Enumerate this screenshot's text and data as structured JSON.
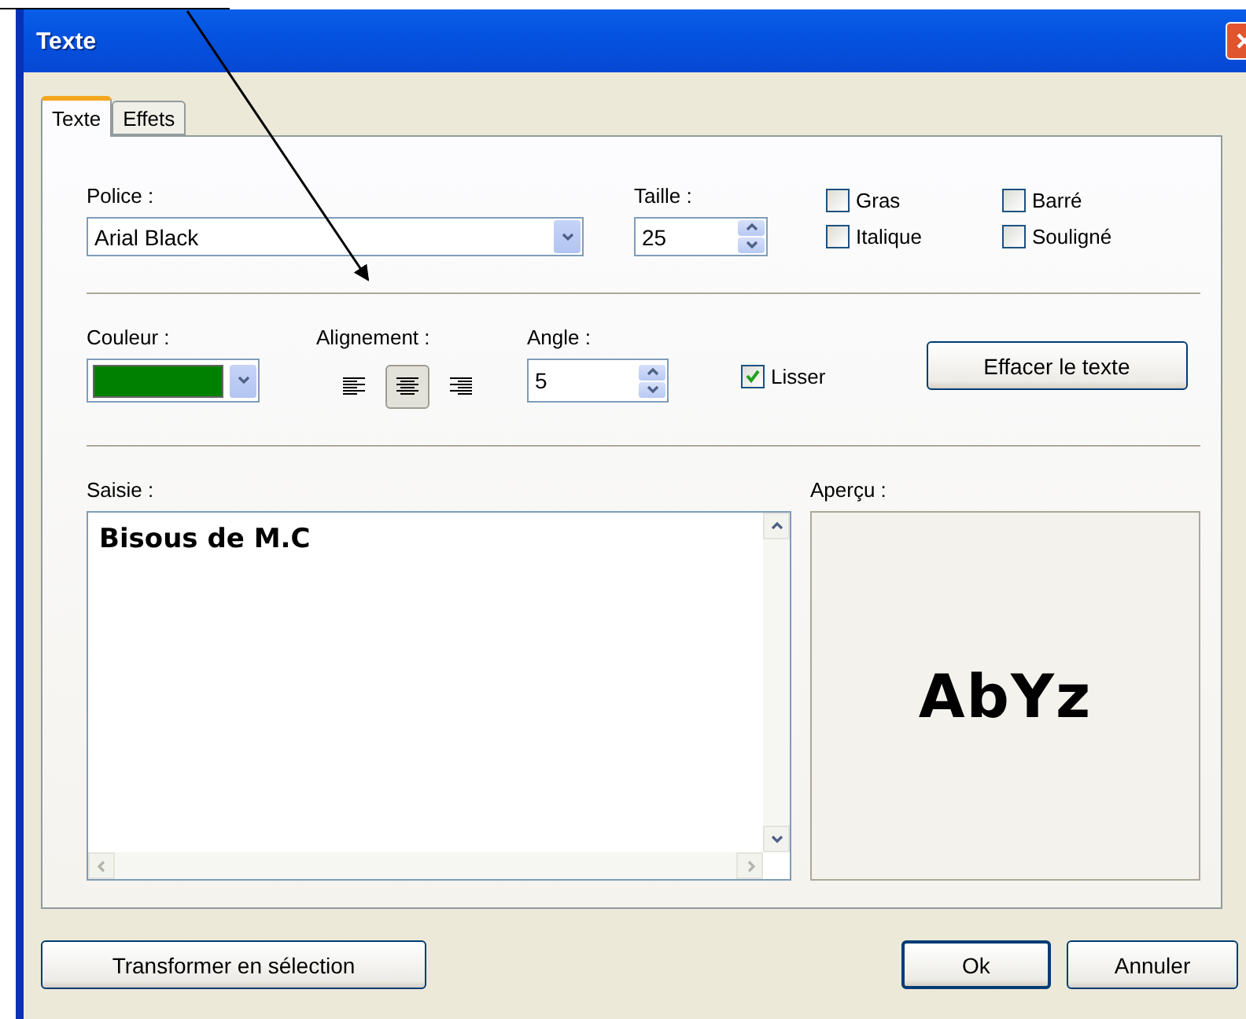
{
  "window": {
    "title": "Texte"
  },
  "tabs": [
    {
      "label": "Texte",
      "selected": true
    },
    {
      "label": "Effets",
      "selected": false
    }
  ],
  "font": {
    "label": "Police :",
    "value": "Arial Black"
  },
  "size": {
    "label": "Taille :",
    "value": "25"
  },
  "styles": [
    {
      "label": "Gras",
      "checked": false
    },
    {
      "label": "Barré",
      "checked": false
    },
    {
      "label": "Italique",
      "checked": false
    },
    {
      "label": "Souligné",
      "checked": false
    }
  ],
  "color": {
    "label": "Couleur :",
    "color": "#008000"
  },
  "alignment": {
    "label": "Alignement :",
    "options": [
      {
        "kind": "left",
        "selected": false
      },
      {
        "kind": "center",
        "selected": true
      },
      {
        "kind": "right",
        "selected": false
      }
    ]
  },
  "angle": {
    "label": "Angle :",
    "value": "5"
  },
  "smooth": {
    "label": "Lisser",
    "checked": true
  },
  "clear_button": "Effacer le texte",
  "input": {
    "label": "Saisie :",
    "value": "Bisous de M.C"
  },
  "preview": {
    "label": "Aperçu :",
    "sample": "AbYz"
  },
  "buttons": {
    "convert": "Transformer en sélection",
    "ok": "Ok",
    "cancel": "Annuler"
  }
}
